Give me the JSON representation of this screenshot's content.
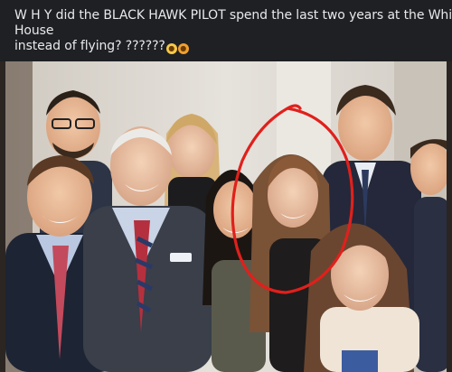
{
  "post": {
    "caption_line1": "W H Y did the BLACK HAWK PILOT spend the last two years at the White",
    "caption_line2": "House",
    "caption_line3": "instead of flying? ??????",
    "emojis": [
      "face-screaming-in-fear-icon",
      "exploding-head-icon"
    ]
  },
  "photo": {
    "description_tag": "group-photo",
    "highlight_color": "#e0201c"
  }
}
